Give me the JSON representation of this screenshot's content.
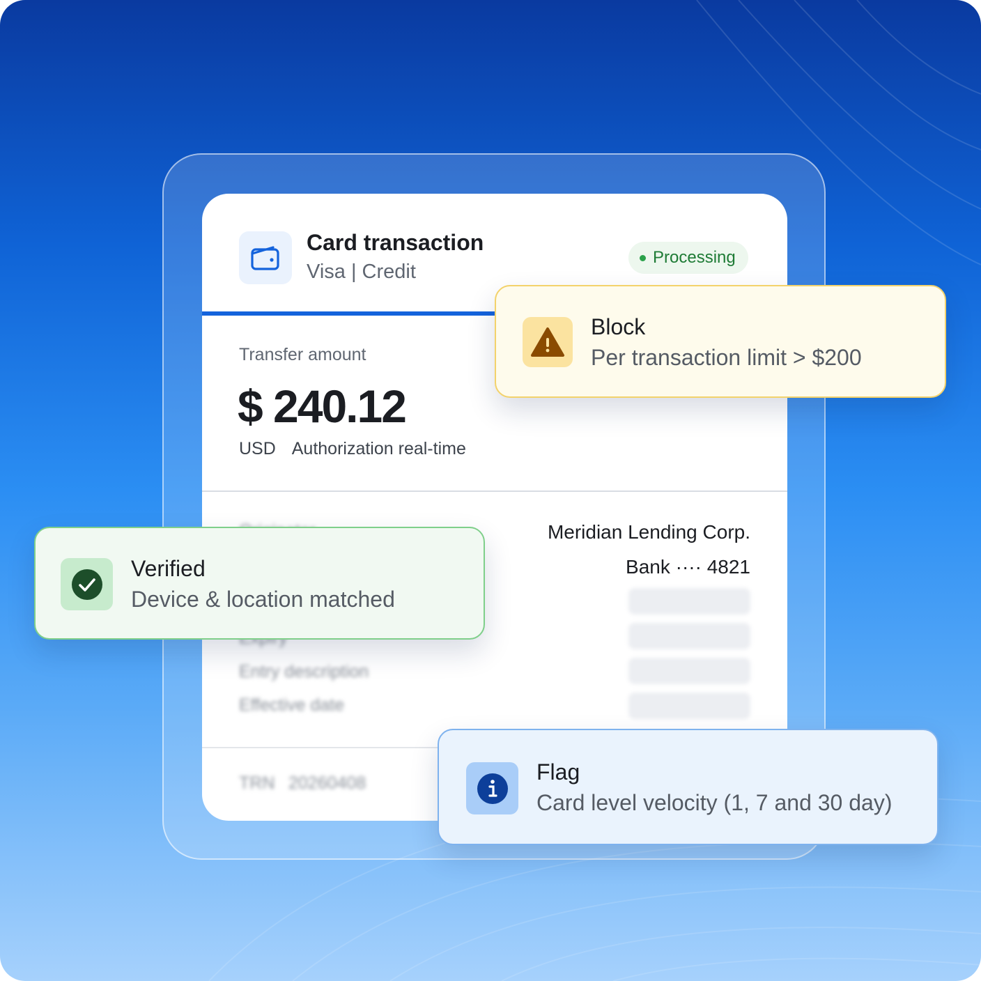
{
  "transaction": {
    "title": "Card transaction",
    "subtitle": "Visa | Credit",
    "status": "Processing",
    "amount_label": "Transfer amount",
    "amount": "$ 240.12",
    "currency": "USD",
    "authorization": "Authorization real-time",
    "merchant": "Meridian Lending Corp.",
    "bank": "Bank ···· 4821",
    "detail_labels": [
      "Originator",
      "Expiry",
      "Entry description",
      "Effective date"
    ],
    "trn_label": "TRN",
    "trn_value": "20260408"
  },
  "notices": {
    "block": {
      "title": "Block",
      "text": "Per transaction limit > $200"
    },
    "verified": {
      "title": "Verified",
      "text": "Device & location matched"
    },
    "flag": {
      "title": "Flag",
      "text": "Card level velocity (1, 7 and 30 day)"
    }
  },
  "colors": {
    "accent": "#1463dc",
    "status_green": "#1e7b35",
    "warning": "#8a4b00",
    "success": "#1d4e2a",
    "info": "#0d3f9a"
  },
  "icons": {
    "transaction": "wallet-icon",
    "block": "warning-triangle-icon",
    "verified": "check-circle-icon",
    "flag": "info-circle-icon"
  }
}
